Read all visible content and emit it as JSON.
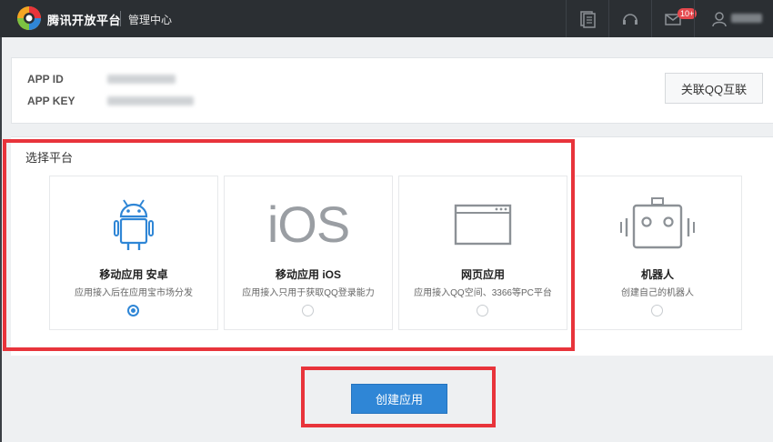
{
  "header": {
    "brand": "腾讯开放平台",
    "subtitle": "管理中心",
    "badge": "10+",
    "icons": [
      "document-icon",
      "headset-icon",
      "mail-icon",
      "user-icon"
    ]
  },
  "app_info": {
    "app_id_label": "APP ID",
    "app_key_label": "APP KEY",
    "unbind_button": "关联QQ互联"
  },
  "platform": {
    "section_title": "选择平台",
    "options": [
      {
        "title": "移动应用 安卓",
        "desc": "应用接入后在应用宝市场分发",
        "icon": "android-icon",
        "selected": true
      },
      {
        "title": "移动应用 iOS",
        "desc": "应用接入只用于获取QQ登录能力",
        "icon": "ios-icon",
        "selected": false
      },
      {
        "title": "网页应用",
        "desc": "应用接入QQ空间、3366等PC平台",
        "icon": "web-browser-icon",
        "selected": false
      },
      {
        "title": "机器人",
        "desc": "创建自己的机器人",
        "icon": "robot-icon",
        "selected": false
      }
    ]
  },
  "ios_logo_text": "iOS",
  "create_button": "创建应用",
  "colors": {
    "topbar": "#2b2f33",
    "accent": "#2f86d6",
    "annotation_red": "#e8343b",
    "icon_gray": "#8c9196"
  }
}
